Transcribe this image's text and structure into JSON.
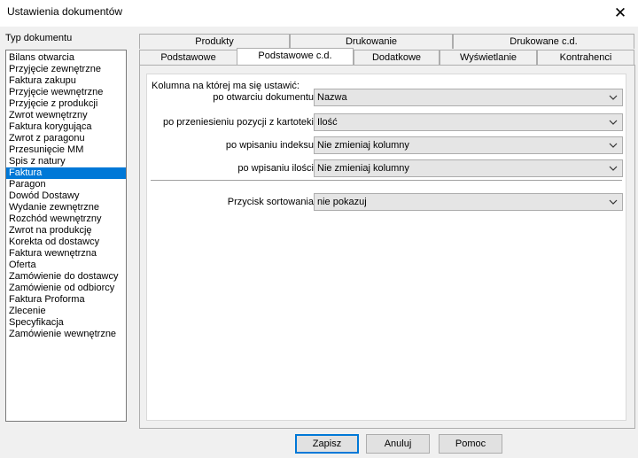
{
  "window": {
    "title": "Ustawienia dokumentów",
    "close_glyph": "✕"
  },
  "doc_types": {
    "label": "Typ dokumentu",
    "items": [
      "Bilans otwarcia",
      "Przyjęcie zewnętrzne",
      "Faktura zakupu",
      "Przyjęcie wewnętrzne",
      "Przyjęcie z produkcji",
      "Zwrot wewnętrzny",
      "Faktura korygująca",
      "Zwrot z paragonu",
      "Przesunięcie MM",
      "Spis z natury",
      "Faktura",
      "Paragon",
      "Dowód Dostawy",
      "Wydanie zewnętrzne",
      "Rozchód wewnętrzny",
      "Zwrot na produkcję",
      "Korekta od dostawcy",
      "Faktura wewnętrzna",
      "Oferta",
      "Zamówienie do dostawcy",
      "Zamówienie od odbiorcy",
      "Faktura Proforma",
      "Zlecenie",
      "Specyfikacja",
      "Zamówienie wewnętrzne"
    ],
    "selected": "Faktura"
  },
  "tabs": {
    "top_row": [
      "Produkty",
      "Drukowanie",
      "Drukowane c.d."
    ],
    "bottom_row": [
      "Podstawowe",
      "Podstawowe c.d.",
      "Dodatkowe",
      "Wyświetlanie",
      "Kontrahenci"
    ],
    "active": "Podstawowe c.d."
  },
  "panel": {
    "heading": "Kolumna na której ma się ustawić:",
    "rows": [
      {
        "label": "po otwarciu dokumentu",
        "value": "Nazwa"
      },
      {
        "label": "po przeniesieniu pozycji z kartoteki",
        "value": "Ilość"
      },
      {
        "label": "po wpisaniu indeksu",
        "value": "Nie zmieniaj kolumny"
      },
      {
        "label": "po wpisaniu ilości",
        "value": "Nie zmieniaj kolumny"
      }
    ],
    "sort_row": {
      "label": "Przycisk sortowania",
      "value": "nie pokazuj"
    }
  },
  "buttons": {
    "save": "Zapisz",
    "cancel": "Anuluj",
    "help": "Pomoc"
  }
}
